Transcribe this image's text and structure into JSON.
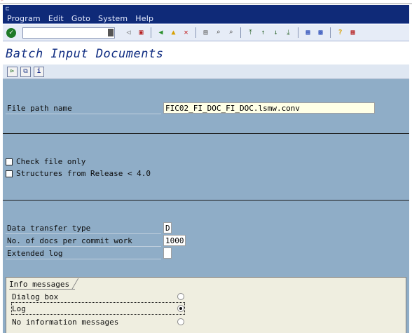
{
  "menubar": {
    "items": [
      {
        "label": "Program"
      },
      {
        "label": "Edit"
      },
      {
        "label": "Goto"
      },
      {
        "label": "System"
      },
      {
        "label": "Help"
      }
    ]
  },
  "toolbar": {
    "command_field_value": "",
    "icons": [
      "enter-check-icon",
      "save-icon",
      "back-icon",
      "exit-icon",
      "cancel-icon",
      "print-icon",
      "find-icon",
      "find-next-icon",
      "first-page-icon",
      "previous-page-icon",
      "next-page-icon",
      "last-page-icon",
      "create-session-icon",
      "shortcut-icon",
      "help-icon",
      "layout-menu-icon"
    ]
  },
  "page": {
    "title": "Batch Input Documents"
  },
  "app_toolbar": {
    "icons": [
      "execute-icon",
      "copy-icon",
      "info-icon"
    ]
  },
  "file_section": {
    "file_path_label": "File path name",
    "file_path_value": "FIC02_FI_DOC_FI_DOC.lsmw.conv"
  },
  "options": {
    "check_file_only": "Check file only",
    "structures_from_release": "Structures from Release < 4.0"
  },
  "transfer": {
    "data_transfer_type_label": "Data transfer type",
    "data_transfer_type_value": "D",
    "docs_per_commit_label": "No. of docs per commit work",
    "docs_per_commit_value": "1000",
    "extended_log_label": "Extended log",
    "extended_log_value": ""
  },
  "info_messages": {
    "title": "Info messages",
    "options": [
      {
        "label": "Dialog box",
        "selected": false
      },
      {
        "label": "Log",
        "selected": true
      },
      {
        "label": "No information messages",
        "selected": false
      }
    ]
  }
}
